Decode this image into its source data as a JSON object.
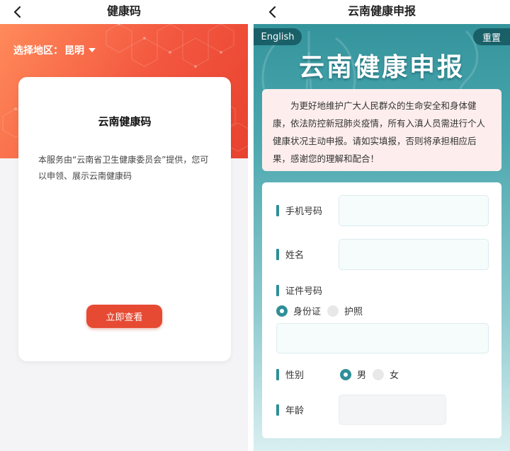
{
  "left": {
    "nav_title": "健康码",
    "region_label": "选择地区：",
    "region_value": "昆明",
    "card_title": "云南健康码",
    "card_desc": "本服务由“云南省卫生健康委员会”提供，您可以申领、展示云南健康码",
    "view_button": "立即查看",
    "accent_color": "#e64a32"
  },
  "right": {
    "nav_title": "云南健康申报",
    "english_button": "English",
    "reset_button": "重置",
    "banner_title": "云南健康申报",
    "notice": "为更好地维护广大人民群众的生命安全和身体健康，依法防控新冠肺炎疫情，所有入滇人员需进行个人健康状况主动申报。请如实填报，否则将承担相应后果，感谢您的理解和配合！",
    "accent_color": "#2f8f98",
    "form": {
      "phone_label": "手机号码",
      "name_label": "姓名",
      "id_label": "证件号码",
      "id_type_options": [
        "身份证",
        "护照"
      ],
      "id_type_selected": "身份证",
      "gender_label": "性别",
      "gender_options": [
        "男",
        "女"
      ],
      "gender_selected": "男",
      "age_label": "年龄"
    }
  },
  "icons": [
    "back-chevron-icon",
    "caret-down-icon",
    "radio-selected-icon",
    "radio-unselected-icon"
  ]
}
